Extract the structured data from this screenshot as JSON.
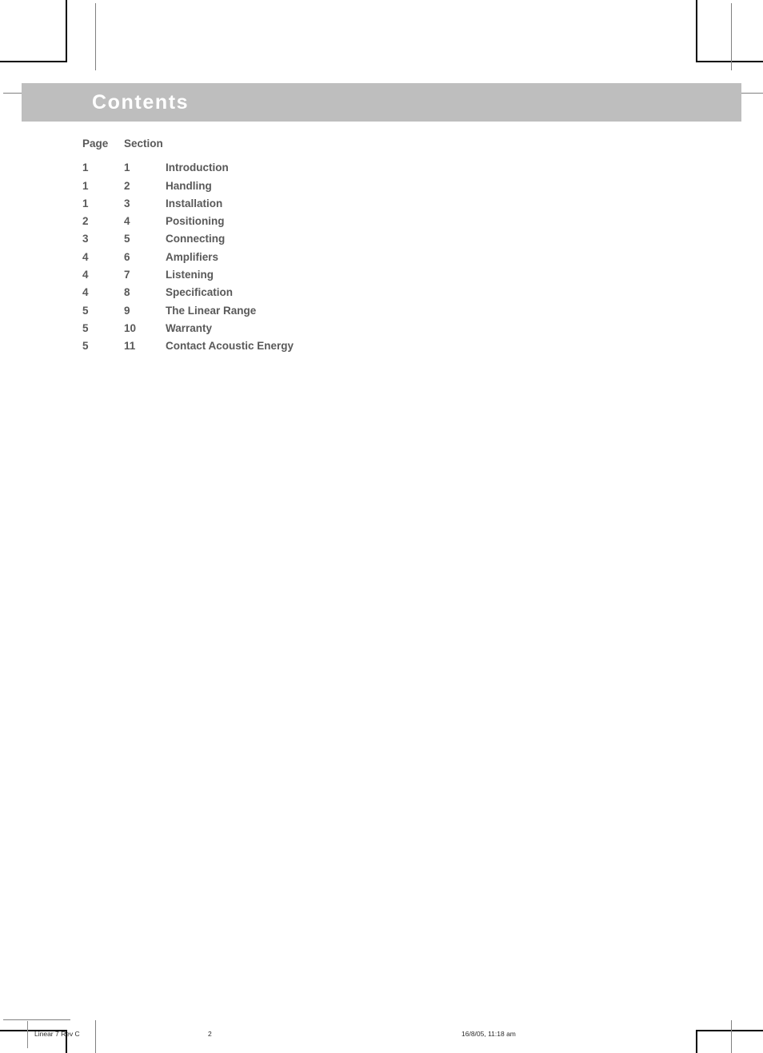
{
  "document": {
    "section_band": {
      "title": "Contents",
      "band_color": "#bebebe",
      "title_color": "#ffffff"
    },
    "toc": {
      "headers": {
        "page": "Page",
        "section": "Section"
      },
      "text_color": "#595959",
      "rows": [
        {
          "page": "1",
          "section": "1",
          "title": "Introduction"
        },
        {
          "page": "1",
          "section": "2",
          "title": "Handling"
        },
        {
          "page": "1",
          "section": "3",
          "title": "Installation"
        },
        {
          "page": "2",
          "section": "4",
          "title": "Positioning"
        },
        {
          "page": "3",
          "section": "5",
          "title": "Connecting"
        },
        {
          "page": "4",
          "section": "6",
          "title": "Amplifiers"
        },
        {
          "page": "4",
          "section": "7",
          "title": "Listening"
        },
        {
          "page": "4",
          "section": "8",
          "title": "Specification"
        },
        {
          "page": "5",
          "section": "9",
          "title": "The Linear Range"
        },
        {
          "page": "5",
          "section": "10",
          "title": "Warranty"
        },
        {
          "page": "5",
          "section": "11",
          "title": "Contact Acoustic Energy"
        }
      ]
    },
    "footer": {
      "document_name": "Linear 7 Rev C",
      "page_number": "2",
      "timestamp": "16/8/05, 11:18 am"
    }
  }
}
